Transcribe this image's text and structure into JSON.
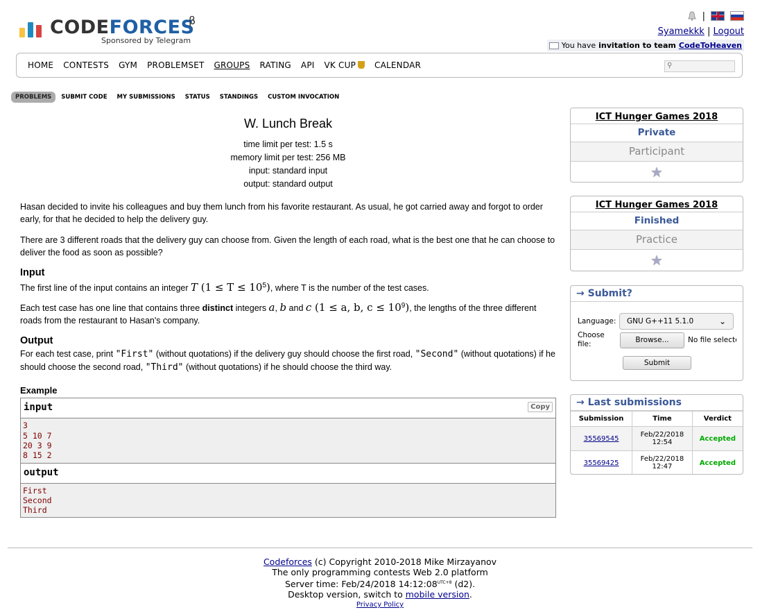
{
  "brand": {
    "part1": "CODE",
    "part2": "FORCES",
    "beta": "β",
    "sponsor": "Sponsored by Telegram"
  },
  "header": {
    "separator": "|",
    "username": "Syamekkk",
    "user_sep": "|",
    "logout": "Logout",
    "invite_prefix": "You have",
    "invite_bold": "invitation to team",
    "team": "CodeToHeaven"
  },
  "menu": [
    "HOME",
    "CONTESTS",
    "GYM",
    "PROBLEMSET",
    "GROUPS",
    "RATING",
    "API",
    "VK CUP",
    "CALENDAR"
  ],
  "menu_active": "GROUPS",
  "subtabs": [
    "PROBLEMS",
    "SUBMIT CODE",
    "MY SUBMISSIONS",
    "STATUS",
    "STANDINGS",
    "CUSTOM INVOCATION"
  ],
  "problem": {
    "title": "W. Lunch Break",
    "time_limit": "time limit per test: 1.5 s",
    "memory_limit": "memory limit per test: 256 MB",
    "input": "input: standard input",
    "output": "output: standard output",
    "p1": "Hasan decided to invite his colleagues and buy them lunch from his favorite restaurant. As usual, he got carried away and forgot to order early, for that he decided to help the delivery guy.",
    "p2": "There are 3 different roads that the delivery guy can choose from. Given the length of each road, what is the best one that he can choose to deliver the food as soon as possible?",
    "input_h": "Input",
    "in1_a": "The first line of the input contains an integer ",
    "in1_m1": "T",
    "in1_m2": " (1 ≤ T ≤ 10",
    "in1_exp": "5",
    "in1_m3": ")",
    "in1_b": ", where T is the number of the test cases.",
    "in2_a": "Each test case has one line that contains three ",
    "in2_bold": "distinct",
    "in2_b": " integers ",
    "in2_m1": "a",
    "in2_c": ", ",
    "in2_m2": "b",
    "in2_d": " and ",
    "in2_m3": "c",
    "in2_m4": " (1 ≤ a, b, c ≤ 10",
    "in2_exp": "9",
    "in2_m5": ")",
    "in2_e": ", the lengths of the three different roads from the restaurant to Hasan's company.",
    "output_h": "Output",
    "out_a": "For each test case, print ",
    "out_c1": "\"First\"",
    "out_b": " (without quotations) if the delivery guy should choose the first road, ",
    "out_c2": "\"Second\"",
    "out_c": " (without quotations) if he should choose the second road, ",
    "out_c3": "\"Third\"",
    "out_d": " (without quotations) if he should choose the third way.",
    "example_h": "Example",
    "sample_input_h": "input",
    "copy": "Copy",
    "sample_input": "3\n5 10 7\n20 3 9\n8 15 2",
    "sample_output_h": "output",
    "sample_output": "First\nSecond\nThird"
  },
  "sidebar": {
    "contest1": {
      "name": "ICT Hunger Games 2018",
      "kind": "Private",
      "role": "Participant"
    },
    "contest2": {
      "name": "ICT Hunger Games 2018",
      "kind": "Finished",
      "role": "Practice"
    },
    "submit": {
      "caption": "→ Submit?",
      "language_label": "Language:",
      "language_value": "GNU G++11 5.1.0",
      "file_label_1": "Choose",
      "file_label_2": "file:",
      "browse": "Browse...",
      "no_file": "No file selected.",
      "submit_btn": "Submit"
    },
    "last": {
      "caption": "→ Last submissions",
      "headers": [
        "Submission",
        "Time",
        "Verdict"
      ],
      "rows": [
        {
          "id": "35569545",
          "date": "Feb/22/2018",
          "time": "12:54",
          "verdict": "Accepted"
        },
        {
          "id": "35569425",
          "date": "Feb/22/2018",
          "time": "12:47",
          "verdict": "Accepted"
        }
      ]
    }
  },
  "footer": {
    "cf": "Codeforces",
    "copyright": " (c) Copyright 2010-2018 Mike Mirzayanov",
    "line2": "The only programming contests Web 2.0 platform",
    "server_prefix": "Server time: Feb/24/2018 14:12:08",
    "utc": "UTC+8",
    "server_suffix": " (d2).",
    "desk_prefix": "Desktop version, switch to ",
    "mobile": "mobile version",
    "desk_suffix": ".",
    "privacy": "Privacy Policy"
  },
  "colors": {
    "brand_blue": "#1f5fa5",
    "accepted": "#00aa00",
    "link": "#00008b",
    "caption": "#3b5998"
  }
}
